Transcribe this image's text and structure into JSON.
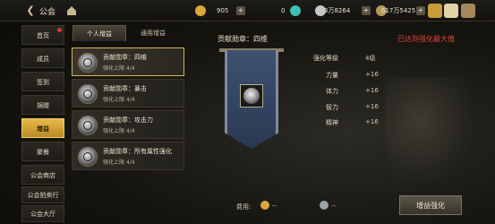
{
  "header": {
    "title": "公会",
    "resources": [
      {
        "icon": "gold-coin-icon",
        "value": "905"
      },
      {
        "icon": "diamond-icon",
        "value": "0"
      },
      {
        "icon": "silver-icon",
        "value": "3万8264"
      },
      {
        "icon": "coin-stack-icon",
        "value": "617万5425"
      }
    ]
  },
  "nav": {
    "items": [
      {
        "label": "首页",
        "badge": true
      },
      {
        "label": "成员"
      },
      {
        "label": "签到"
      },
      {
        "label": "捐赠"
      },
      {
        "label": "增益",
        "active": true
      },
      {
        "label": "聚餐"
      },
      {
        "label": "公会商店"
      },
      {
        "label": "公会拍卖行"
      },
      {
        "label": "公会大厅"
      }
    ]
  },
  "tabs": {
    "personal": "个人增益",
    "general": "通用增益"
  },
  "buff_list": [
    {
      "name": "贡献勋章：四维",
      "level": "强化上限 4/4",
      "selected": true
    },
    {
      "name": "贡献勋章：暴击",
      "level": "强化上限 4/4"
    },
    {
      "name": "贡献勋章：攻击力",
      "level": "强化上限 4/4"
    },
    {
      "name": "贡献勋章：所有属性强化",
      "level": "强化上限 4/4"
    }
  ],
  "detail": {
    "title": "贡献勋章：四维",
    "max_notice": "已达到强化最大值",
    "stats": [
      {
        "label": "强化等级",
        "value": "4级"
      },
      {
        "label": "力量",
        "value": "+16"
      },
      {
        "label": "体力",
        "value": "+16"
      },
      {
        "label": "智力",
        "value": "+16"
      },
      {
        "label": "精神",
        "value": "+16"
      }
    ]
  },
  "footer": {
    "cost_label": "费用:",
    "cost1": "--",
    "cost2": "--",
    "action_label": "增益强化"
  },
  "colors": {
    "accent": "#e8b84a",
    "alert": "#e2443a",
    "banner": "#3e5270"
  }
}
